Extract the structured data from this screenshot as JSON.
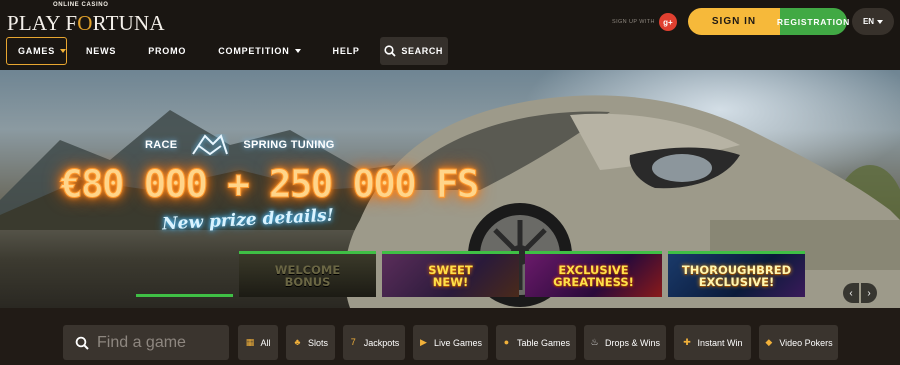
{
  "header": {
    "logo_tagline": "ONLINE CASINO",
    "logo_text_before": "PLAY F",
    "logo_text_o": "O",
    "logo_text_after": "RTUNA",
    "social_label": "SIGN UP WITH",
    "gplus_label": "g+",
    "signin_label": "SIGN IN",
    "registration_label": "REGISTRATION",
    "language": "EN"
  },
  "nav": {
    "games": "GAMES",
    "news": "NEWS",
    "promo": "PROMO",
    "competition": "COMPETITION",
    "help": "HELP",
    "search": "SEARCH"
  },
  "banner": {
    "race_left": "RACE",
    "race_right": "SPRING TUNING",
    "prize": "€80 000 + 250 000 FS",
    "prize_sub": "New prize details!",
    "thumbs": [
      {
        "line1": "WELCOME",
        "line2": "BONUS"
      },
      {
        "line1": "SWEET",
        "line2": "NEW!"
      },
      {
        "line1": "EXCLUSIVE",
        "line2": "GREATNESS!"
      },
      {
        "line1": "THOROUGHBRED",
        "line2": "EXCLUSIVE!"
      }
    ],
    "arrow_left": "‹",
    "arrow_right": "›"
  },
  "categories": {
    "search_placeholder": "Find a game",
    "items": [
      {
        "label": "All",
        "icon": "grid-icon"
      },
      {
        "label": "Slots",
        "icon": "cherries-icon"
      },
      {
        "label": "Jackpots",
        "icon": "seven-icon"
      },
      {
        "label": "Live Games",
        "icon": "play-icon"
      },
      {
        "label": "Table Games",
        "icon": "chip-icon"
      },
      {
        "label": "Drops & Wins",
        "icon": "drops-icon"
      },
      {
        "label": "Instant Win",
        "icon": "gamepad-icon"
      },
      {
        "label": "Video Pokers",
        "icon": "spade-icon"
      }
    ]
  },
  "colors": {
    "accent": "#f6b93a",
    "registration": "#41a944",
    "background": "#1d1814"
  }
}
